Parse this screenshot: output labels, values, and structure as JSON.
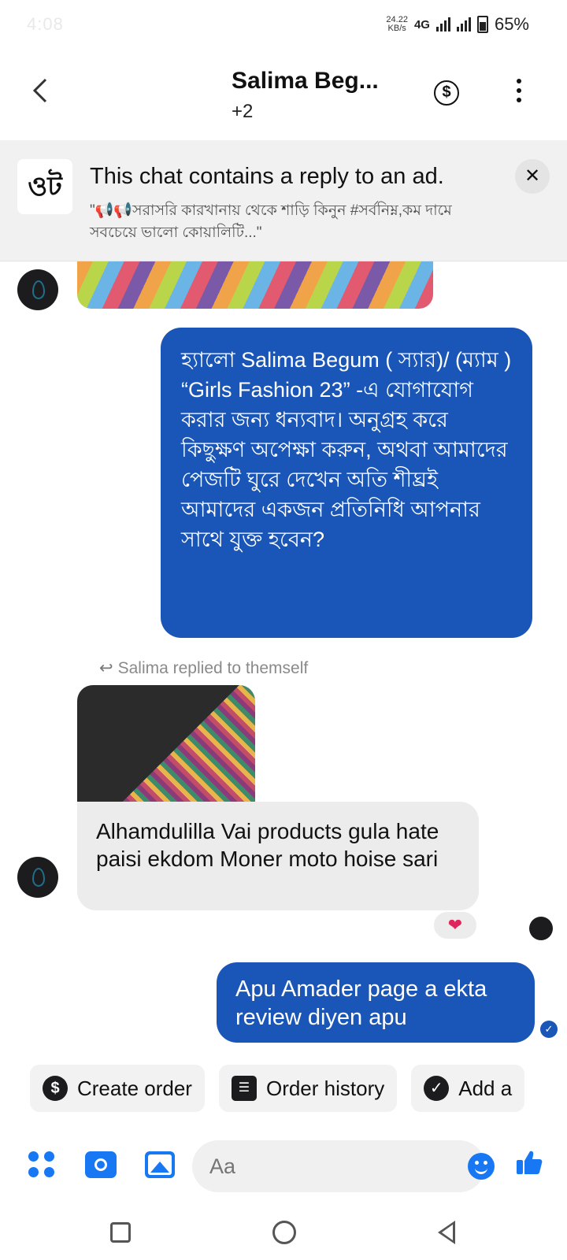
{
  "status_bar": {
    "time": "4:08",
    "net_speed_value": "24.22",
    "net_speed_unit": "KB/s",
    "network_type": "4G",
    "battery": "65%"
  },
  "header": {
    "back_icon": "chevron-left-icon",
    "title": "Salima Beg...",
    "subtitle": "+2",
    "dollar_icon": "dollar-circle-icon",
    "more_icon": "more-vertical-icon"
  },
  "ad_banner": {
    "logo_text": "ওট",
    "title": "This chat contains a reply to an ad.",
    "preview": "\"📢📢সরাসরি কারখানায় থেকে শাড়ি কিনুন #সর্বনিম্ন,কম দামে সবচেয়ে ভালো কোয়ালিটি...\"",
    "close_label": "✕"
  },
  "messages": {
    "auto_reply": "হ্যালো Salima Begum ( স্যার)/ (ম্যাম )\n “Girls Fashion 23” -এ যোগাযোগ করার জন্য ধন্যবাদ। অনুগ্রহ করে কিছুক্ষণ অপেক্ষা করুন, অথবা আমাদের পেজটি ঘুরে দেখেন অতি শীঘ্রই আমাদের একজন প্রতিনিধি আপনার সাথে যুক্ত হবেন?",
    "reply_note": "Salima replied to themself",
    "customer_text": "Alhamdulilla Vai products gula hate paisi ekdom Moner moto hoise sari",
    "reaction": "❤",
    "outgoing_text": "Apu Amader page a ekta review diyen apu",
    "seen_icon": "check-circle-icon"
  },
  "actions": {
    "create_order": "Create order",
    "order_history": "Order history",
    "add": "Add a"
  },
  "composer": {
    "placeholder": "Aa"
  },
  "colors": {
    "outgoing_bubble": "#1a56b7",
    "incoming_bubble": "#ececec",
    "accent": "#1877f2"
  }
}
